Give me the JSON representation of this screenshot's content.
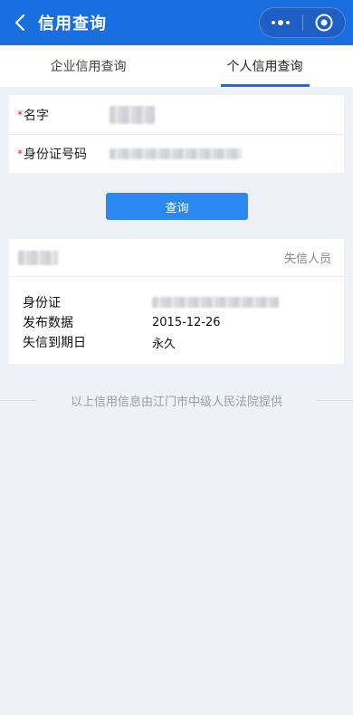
{
  "header": {
    "title": "信用查询",
    "accent": "#1a6fe0"
  },
  "tabs": [
    {
      "label": "企业信用查询",
      "active": false
    },
    {
      "label": "个人信用查询",
      "active": true
    }
  ],
  "form": {
    "required_mark": "*",
    "name_label": "名字",
    "id_label": "身份证号码"
  },
  "search_button": "查询",
  "result": {
    "status": "失信人员",
    "rows": [
      {
        "label": "身份证",
        "value": ""
      },
      {
        "label": "发布数据",
        "value": "2015-12-26"
      },
      {
        "label": "失信到期日",
        "value": "永久"
      }
    ]
  },
  "footer": {
    "text": "以上信用信息由江门市中级人民法院提供"
  }
}
